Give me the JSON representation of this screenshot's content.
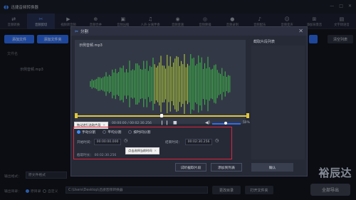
{
  "app": {
    "title": "迅捷音频转换器",
    "window_controls": [
      "—",
      "□",
      "✕"
    ]
  },
  "toolbar": [
    {
      "label": "音频转换",
      "icon": "⇄",
      "active": false
    },
    {
      "label": "音频剪切",
      "icon": "✂",
      "active": true
    },
    {
      "label": "视频转音频",
      "icon": "▶",
      "active": false
    },
    {
      "label": "音频合并",
      "icon": "⊕",
      "active": false
    },
    {
      "label": "音频压缩",
      "icon": "▣",
      "active": false
    },
    {
      "label": "人声·分离伴奏",
      "icon": "♫",
      "active": false
    },
    {
      "label": "音频变速",
      "icon": "◉",
      "active": false
    },
    {
      "label": "音频降噪",
      "icon": "◎",
      "active": false
    },
    {
      "label": "音频录制",
      "icon": "●",
      "active": false
    },
    {
      "label": "音频配乐",
      "icon": "♪",
      "active": false
    },
    {
      "label": "音频变声",
      "icon": "☺",
      "active": false
    },
    {
      "label": "添加背景音",
      "icon": "⊞",
      "active": false
    },
    {
      "label": "文字转语音",
      "icon": "▤",
      "active": false
    }
  ],
  "main": {
    "add_file": "添加文件",
    "add_folder": "添加文件夹",
    "clear_list": "清空列表",
    "column_file": "文件名",
    "file_row": "示例音频.mp3",
    "output_format_label": "输出格式：",
    "output_format_value": "原文件格式",
    "output_dir_label": "输出目录：",
    "output_dir_option1": "原目录",
    "output_dir_option2": "自定义",
    "output_dir_path": "C:\\Users\\Desktop\\迅捷音频转换器",
    "change_dir": "更改目录",
    "open_folder": "打开文件夹",
    "convert_all": "全部导出"
  },
  "dialog": {
    "title": "分割",
    "close": "✕",
    "file_name": "示例音频.mp3",
    "time_display": "00:00:00 / 00:02:30.256",
    "play_controls": "❙❙ ■",
    "volume_icon": "🔊",
    "volume_pct": "50%",
    "tooltip_top": "拖动进行选取片段",
    "tooltip_bottom": "点击选择当前时间",
    "modes": [
      {
        "label": "手动分割",
        "selected": true
      },
      {
        "label": "平均分割",
        "selected": false
      },
      {
        "label": "按时间分割",
        "selected": false
      }
    ],
    "start_label": "开始时间：",
    "start_value": "00:00:00.000",
    "end_label": "结束时间：",
    "end_value": "00:02:30.256",
    "duration_label": "截取时长：",
    "duration_value": "00:02:30.256",
    "segment_list_title": "截取片段列表",
    "btn_trial": "试听截取片段",
    "btn_add": "添加到列表",
    "btn_confirm": "确认"
  },
  "watermark": "裕辰达",
  "colors": {
    "accent": "#2f6df0",
    "highlight_box": "#e0243a",
    "timeline": "#e0c63a"
  }
}
